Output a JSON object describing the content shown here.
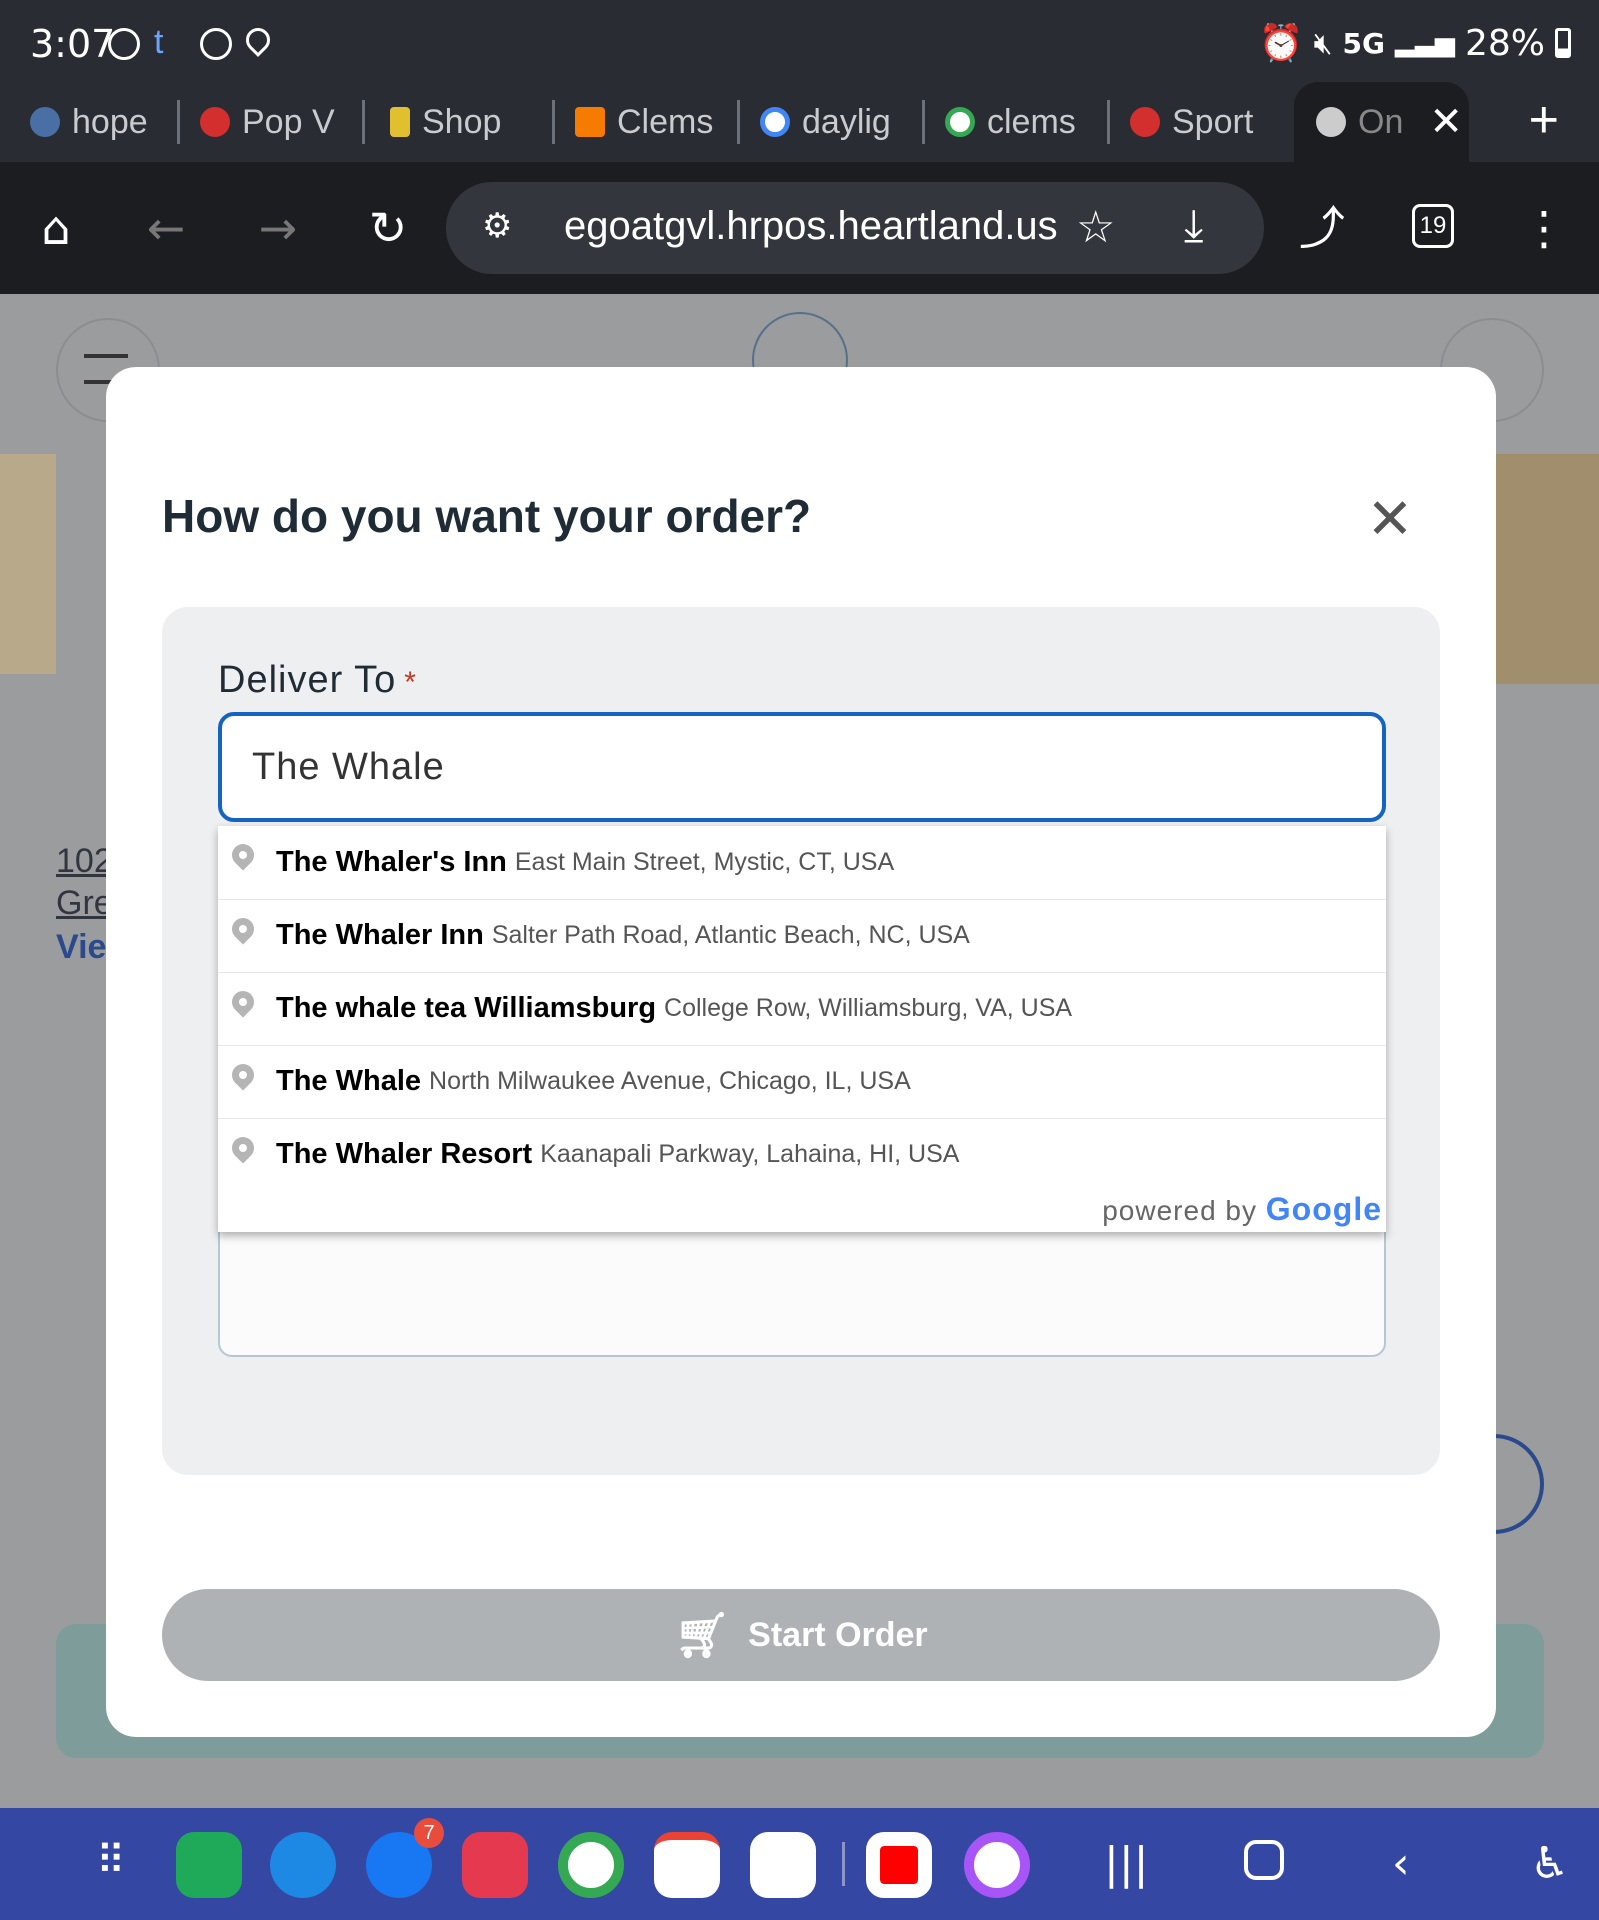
{
  "status_bar": {
    "time": "3:07",
    "network": "5G",
    "battery": "28%"
  },
  "tabs": [
    {
      "label": "hope",
      "color": "#4a6fa5"
    },
    {
      "label": "Pop V",
      "color": "#d32f2f"
    },
    {
      "label": "Shop",
      "color": "#e0c030"
    },
    {
      "label": "Clems",
      "color": "#f57c00"
    },
    {
      "label": "daylig",
      "color": "#ffffff"
    },
    {
      "label": "clems",
      "color": "#ffffff"
    },
    {
      "label": "Sport",
      "color": "#d32f2f"
    },
    {
      "label": "On",
      "color": "#cccccc"
    }
  ],
  "browser": {
    "url": "egoatgvl.hrpos.heartland.us",
    "tab_count": "19"
  },
  "background_page": {
    "address_1": "102",
    "address_2": "Gre",
    "link": "Vie"
  },
  "modal": {
    "title": "How do you want your order?",
    "field_label": "Deliver To",
    "required_mark": "*",
    "input_value": "The Whale",
    "start_button": "Start Order"
  },
  "suggestions": [
    {
      "name": "The Whaler's Inn",
      "address": "East Main Street, Mystic, CT, USA"
    },
    {
      "name": "The Whaler Inn",
      "address": "Salter Path Road, Atlantic Beach, NC, USA"
    },
    {
      "name": "The whale tea Williamsburg",
      "address": "College Row, Williamsburg, VA, USA"
    },
    {
      "name": "The Whale",
      "address": "North Milwaukee Avenue, Chicago, IL, USA"
    },
    {
      "name": "The Whaler Resort",
      "address": "Kaanapali Parkway, Lahaina, HI, USA"
    }
  ],
  "powered_by": {
    "prefix": "powered by",
    "brand": "Google"
  },
  "dock": {
    "facebook_badge": "7"
  },
  "colors": {
    "accent": "#1565c0",
    "nav_bar": "#3447a3",
    "button_disabled": "#aeb2b5"
  }
}
